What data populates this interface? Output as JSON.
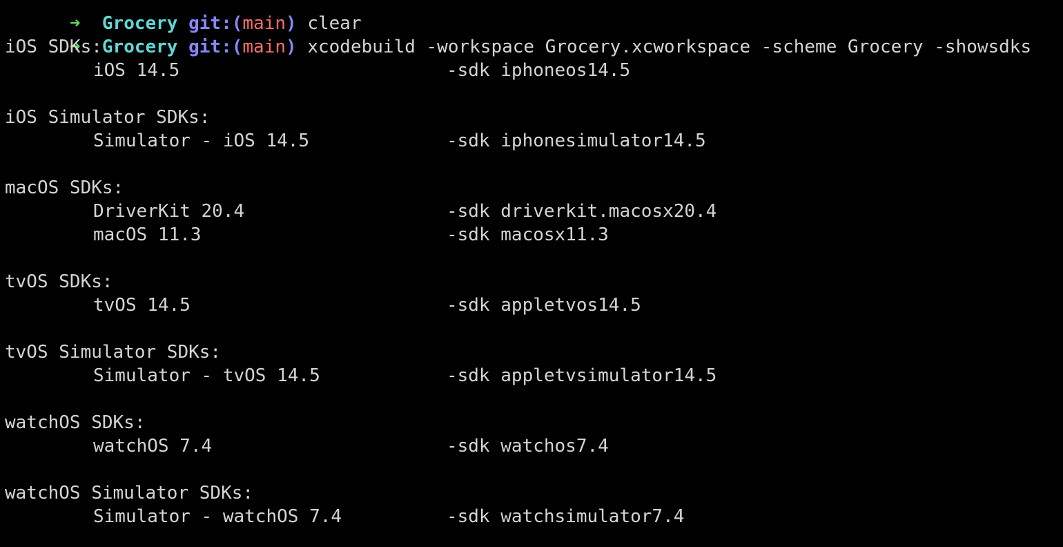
{
  "prompts": [
    {
      "arrow": "➜",
      "dir": "Grocery",
      "git_prefix": "git:(",
      "branch": "main",
      "git_suffix": ")",
      "command": "clear"
    },
    {
      "arrow": "➜",
      "dir": "Grocery",
      "git_prefix": "git:(",
      "branch": "main",
      "git_suffix": ")",
      "command": "xcodebuild -workspace Grocery.xcworkspace -scheme Grocery -showsdks"
    }
  ],
  "sections": [
    {
      "header": "iOS SDKs:",
      "entries": [
        {
          "name": "iOS 14.5",
          "flag": "-sdk iphoneos14.5"
        }
      ]
    },
    {
      "header": "iOS Simulator SDKs:",
      "entries": [
        {
          "name": "Simulator - iOS 14.5",
          "flag": "-sdk iphonesimulator14.5"
        }
      ]
    },
    {
      "header": "macOS SDKs:",
      "entries": [
        {
          "name": "DriverKit 20.4",
          "flag": "-sdk driverkit.macosx20.4"
        },
        {
          "name": "macOS 11.3",
          "flag": "-sdk macosx11.3"
        }
      ]
    },
    {
      "header": "tvOS SDKs:",
      "entries": [
        {
          "name": "tvOS 14.5",
          "flag": "-sdk appletvos14.5"
        }
      ]
    },
    {
      "header": "tvOS Simulator SDKs:",
      "entries": [
        {
          "name": "Simulator - tvOS 14.5",
          "flag": "-sdk appletvsimulator14.5"
        }
      ]
    },
    {
      "header": "watchOS SDKs:",
      "entries": [
        {
          "name": "watchOS 7.4",
          "flag": "-sdk watchos7.4"
        }
      ]
    },
    {
      "header": "watchOS Simulator SDKs:",
      "entries": [
        {
          "name": "Simulator - watchOS 7.4",
          "flag": "-sdk watchsimulator7.4"
        }
      ]
    }
  ],
  "colors": {
    "background": "#000000",
    "foreground": "#d4d4d4",
    "arrow": "#5fd75f",
    "directory": "#5fd7d7",
    "git": "#8787ff",
    "branch": "#ff6b6b"
  }
}
